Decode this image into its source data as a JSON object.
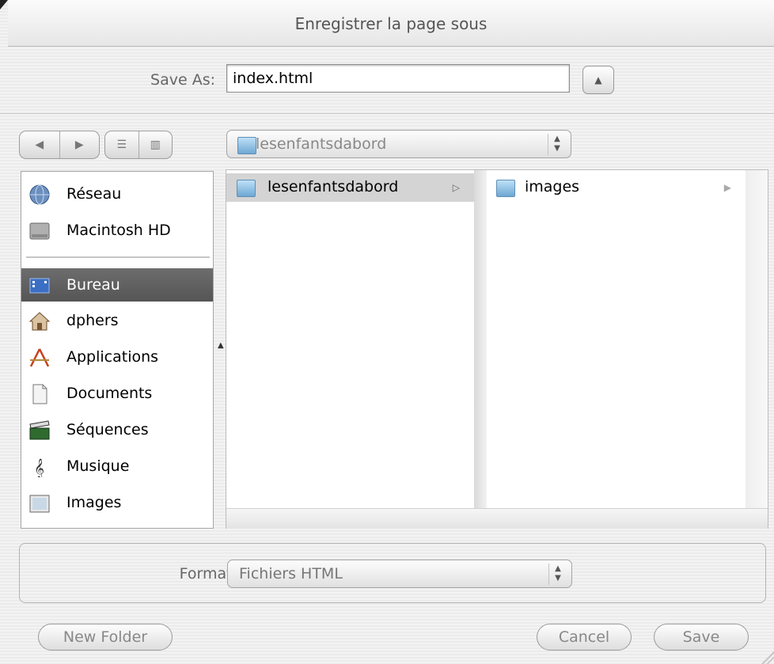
{
  "window": {
    "title": "Enregistrer la page sous"
  },
  "save_as": {
    "label": "Save As:",
    "value": "index.html"
  },
  "path": {
    "current": "lesenfantsdabord"
  },
  "sidebar": {
    "items": [
      {
        "label": "Réseau",
        "icon": "network-globe-icon",
        "selected": false
      },
      {
        "label": "Macintosh HD",
        "icon": "hard-drive-icon",
        "selected": false
      },
      {
        "label": "Bureau",
        "icon": "desktop-icon",
        "selected": true
      },
      {
        "label": "dphers",
        "icon": "home-icon",
        "selected": false
      },
      {
        "label": "Applications",
        "icon": "applications-icon",
        "selected": false
      },
      {
        "label": "Documents",
        "icon": "document-icon",
        "selected": false
      },
      {
        "label": "Séquences",
        "icon": "clapperboard-icon",
        "selected": false
      },
      {
        "label": "Musique",
        "icon": "music-note-icon",
        "selected": false
      },
      {
        "label": "Images",
        "icon": "picture-frame-icon",
        "selected": false
      }
    ]
  },
  "browser": {
    "column1": [
      {
        "label": "lesenfantsdabord",
        "selected": true,
        "has_children": true
      }
    ],
    "column2": [
      {
        "label": "images",
        "selected": false,
        "has_children": true
      }
    ]
  },
  "format": {
    "label": "Format:",
    "value": "Fichiers HTML"
  },
  "buttons": {
    "new_folder": "New Folder",
    "cancel": "Cancel",
    "save": "Save"
  },
  "colors": {
    "selection": "#5c5c5c",
    "folder": "#6ea7d3"
  }
}
